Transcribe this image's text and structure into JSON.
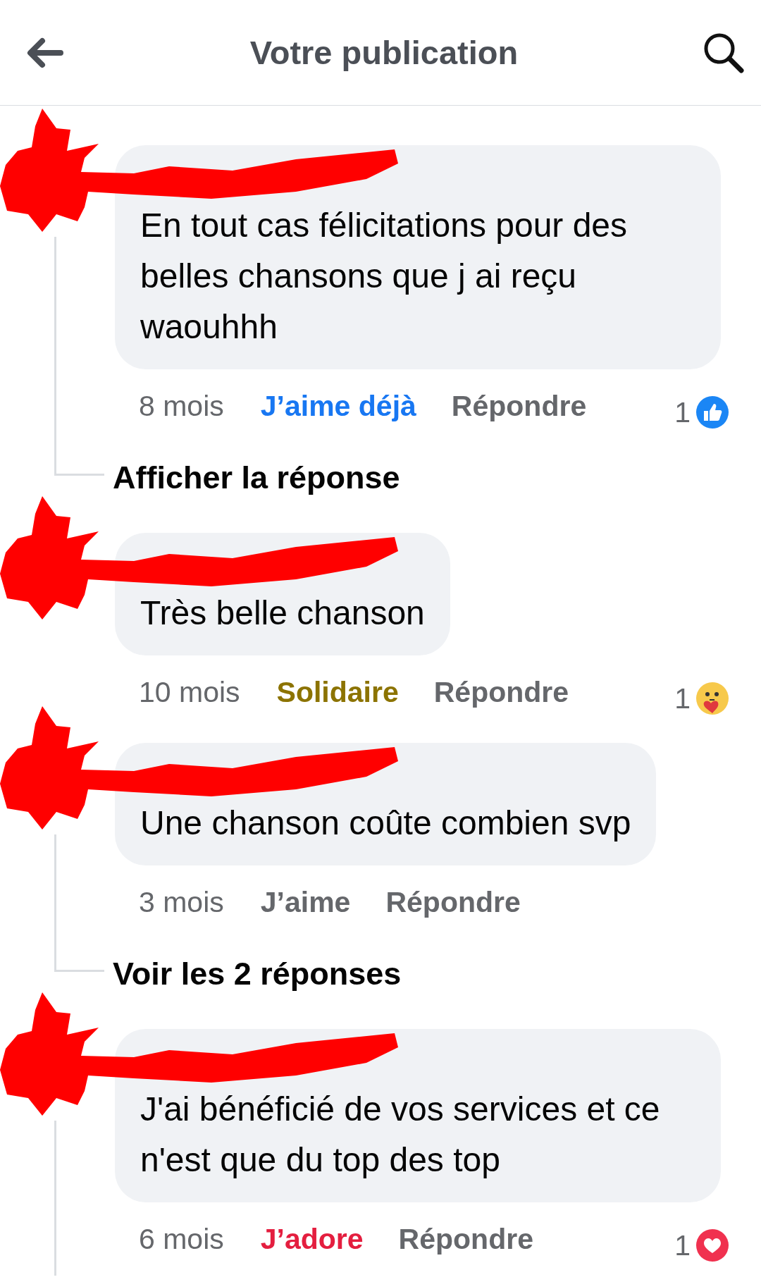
{
  "header": {
    "title": "Votre publication"
  },
  "items": [
    {
      "kind": "comment",
      "text": "En tout cas félicitations pour des belles chansons que j ai reçu waouhhh",
      "time": "8 mois",
      "action": {
        "label": "J’aime déjà",
        "color": "#1877f2"
      },
      "reply": "Répondre",
      "reactions": {
        "count": "1",
        "kind": "like"
      },
      "has_replies": true
    },
    {
      "kind": "replies_link",
      "label": "Afficher la réponse"
    },
    {
      "kind": "comment",
      "text": "Très belle chanson",
      "time": "10 mois",
      "action": {
        "label": "Solidaire",
        "color": "#8c7300"
      },
      "reply": "Répondre",
      "reactions": {
        "count": "1",
        "kind": "care"
      },
      "has_replies": false
    },
    {
      "kind": "comment",
      "text": "Une chanson coûte combien svp",
      "time": "3 mois",
      "action": {
        "label": "J’aime",
        "color": "#65676b"
      },
      "reply": "Répondre",
      "has_replies": true
    },
    {
      "kind": "replies_link",
      "label": "Voir les 2 réponses"
    },
    {
      "kind": "comment",
      "text": "J'ai bénéficié de vos services et ce n'est que du top des top",
      "time": "6 mois",
      "action": {
        "label": "J’adore",
        "color": "#e41e3f"
      },
      "reply": "Répondre",
      "reactions": {
        "count": "1",
        "kind": "love"
      },
      "has_replies": true
    }
  ]
}
